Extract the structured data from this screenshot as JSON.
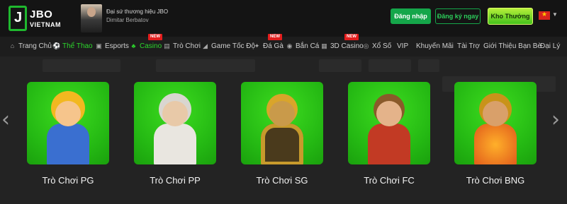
{
  "header": {
    "logo_brand": "JBO",
    "logo_sub": "VIETNAM",
    "ambassador_line1": "Đại sứ thương hiệu JBO",
    "ambassador_line2": "Dimitar Berbatov",
    "login_label": "Đăng nhập",
    "register_label": "Đăng ký ngay",
    "treasure_label": "Kho Thưởng",
    "language_flag": "vietnam-flag"
  },
  "nav": {
    "items": [
      {
        "label": "Trang Chủ",
        "icon": "home-icon"
      },
      {
        "label": "Thể Thao",
        "icon": "soccer-ball-icon",
        "active": true
      },
      {
        "label": "Esports",
        "icon": "gamepad-icon"
      },
      {
        "label": "Casino",
        "icon": "casino-icon",
        "badge": "NEW"
      },
      {
        "label": "Trò Chơi",
        "icon": "slot-machine-icon"
      },
      {
        "label": "Game Tốc Độ",
        "icon": "speed-game-icon"
      },
      {
        "label": "Đá Gà",
        "icon": "rooster-icon",
        "badge": "NEW"
      },
      {
        "label": "Bắn Cá",
        "icon": "fish-icon"
      },
      {
        "label": "3D Casino",
        "icon": "3d-casino-icon",
        "badge": "NEW"
      },
      {
        "label": "Xổ Số",
        "icon": "lottery-icon"
      },
      {
        "label": "VIP",
        "icon": ""
      },
      {
        "label": "Khuyến Mãi",
        "icon": ""
      },
      {
        "label": "Tài Trợ",
        "icon": ""
      },
      {
        "label": "Giới Thiệu Bạn Bè",
        "icon": ""
      },
      {
        "label": "Đại Lý",
        "icon": ""
      }
    ]
  },
  "carousel": {
    "prev_icon": "chevron-left-icon",
    "next_icon": "chevron-right-icon",
    "cards": [
      {
        "label": "Trò Chơi PG",
        "character": "blonde-hero-boy"
      },
      {
        "label": "Trò Chơi PP",
        "character": "zeus"
      },
      {
        "label": "Trò Chơi SG",
        "character": "golden-knight"
      },
      {
        "label": "Trò Chơi FC",
        "character": "monkey-king"
      },
      {
        "label": "Trò Chơi BNG",
        "character": "egyptian-queen"
      }
    ]
  },
  "colors": {
    "brand_green": "#15a64a",
    "active_nav": "#2cd62c",
    "card_green": "#24b813",
    "badge_red": "#e31d1d"
  }
}
